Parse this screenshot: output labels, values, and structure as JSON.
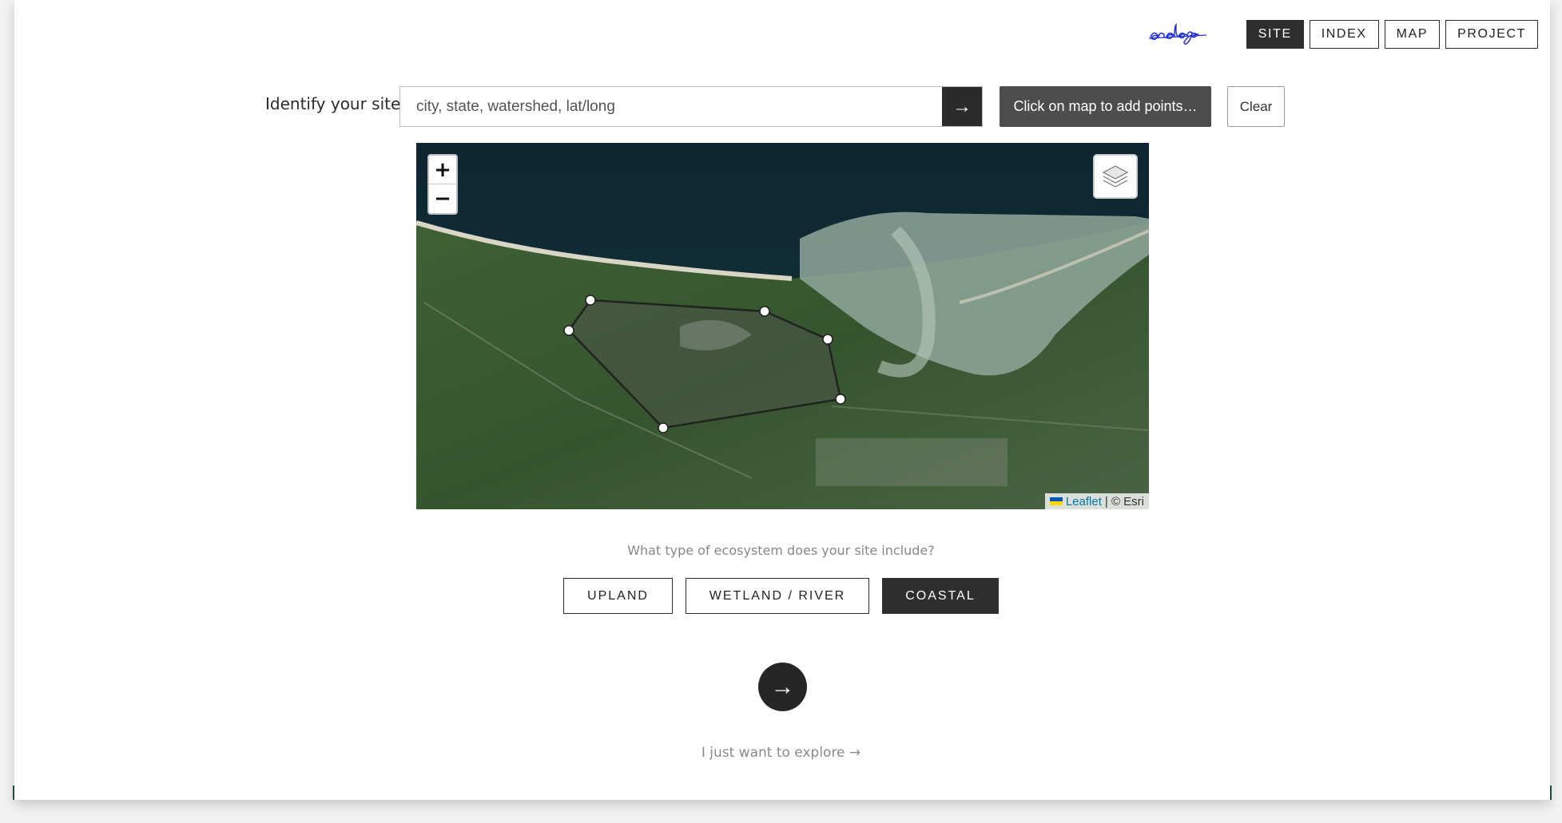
{
  "header": {
    "logo_text": "analogs",
    "nav": [
      {
        "label": "SITE",
        "active": true
      },
      {
        "label": "INDEX",
        "active": false
      },
      {
        "label": "MAP",
        "active": false
      },
      {
        "label": "PROJECT",
        "active": false
      }
    ]
  },
  "site_search": {
    "label": "Identify your site:",
    "placeholder": "city, state, watershed, lat/long",
    "value": "",
    "go_icon": "→",
    "points_button": "Click on map to add points…",
    "clear_button": "Clear"
  },
  "map": {
    "zoom_in": "+",
    "zoom_out": "−",
    "layers_icon": "layers-icon",
    "attribution_link": "Leaflet",
    "attribution_rest": "| © Esri"
  },
  "ecosystem": {
    "question": "What type of ecosystem does your site include?",
    "options": [
      {
        "label": "UPLAND",
        "active": false
      },
      {
        "label": "WETLAND / RIVER",
        "active": false
      },
      {
        "label": "COASTAL",
        "active": true
      }
    ]
  },
  "next_icon": "→",
  "explore_link": "I just want to explore →"
}
